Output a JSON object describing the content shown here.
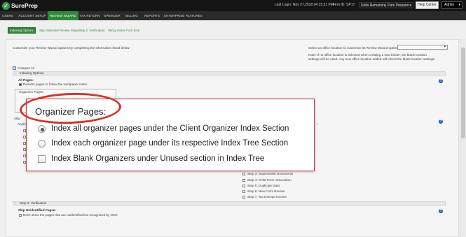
{
  "header": {
    "logo_text": "SurePrep",
    "last_login_label": "Last Login: Nov 27,2018 04:15:31 PM",
    "firm_id_label": "Firm ID: SP17",
    "units_select": "Units Remaining",
    "user_select": "Pam Preparer",
    "help_button": "Help Center",
    "admin_button": "Admin"
  },
  "nav": {
    "items": [
      "USERS",
      "ACCOUNT SETUP",
      "REVIEW WIZARD",
      "TAX RETURN",
      "SPBINDER",
      "BILLING",
      "REPORTS",
      "ENTERPRISE FEATURES"
    ],
    "active": "REVIEW WIZARD"
  },
  "subtabs": [
    "Indexing Options",
    "Skip Selected Review Steps",
    "Step 2: Verification",
    "Sticky Notes Font Size"
  ],
  "main": {
    "intro": "Customize your Review Wizard options by completing the information listed below",
    "location_prompt": "Select an office location to customize its Review Wizard options:",
    "note_line1": "Note: If no office location is selected when creating a new binder, the blank location",
    "note_line2": "settings will be used. Any new office location added will inherit the blank location settings.",
    "collapse_all": "Collapse All",
    "section_indexing": "Indexing Options",
    "all_pages_label": "All Pages:",
    "reorder_pages": "Reorder pages to follow the workpaper index",
    "small_org_label": "Organizer Pages:",
    "partial_b": "Skip",
    "partial_appl": "Applic",
    "partial_r": "r",
    "steps": [
      "Step 3: Superseded Documents",
      "Step 4: Child Form Association",
      "Step 5: Duplicate Data",
      "Step 6: New Form Review",
      "Step 7: Tax Exempt Income"
    ],
    "section_verification": "Step 2: Verification",
    "skip_unidentified": "Skip Unidentified Pages:",
    "dont_show_unidentified": "Don't show the pages that are unidentified/not recognized by OCR"
  },
  "callout": {
    "title": "Organizer Pages:",
    "options": [
      {
        "label": "Index all organizer pages under the Client Organizer Index Section",
        "type": "radio",
        "checked": true
      },
      {
        "label": "Index each organizer page under its respective Index Tree Section",
        "type": "radio",
        "checked": false
      },
      {
        "label": "Index Blank Organizers under Unused section in Index Tree",
        "type": "checkbox",
        "checked": false
      }
    ]
  },
  "colors": {
    "accent_green": "#2f8b3a",
    "callout_red": "#d0362e",
    "header_bg": "#141414",
    "nav_bg": "#2a2a2a"
  }
}
